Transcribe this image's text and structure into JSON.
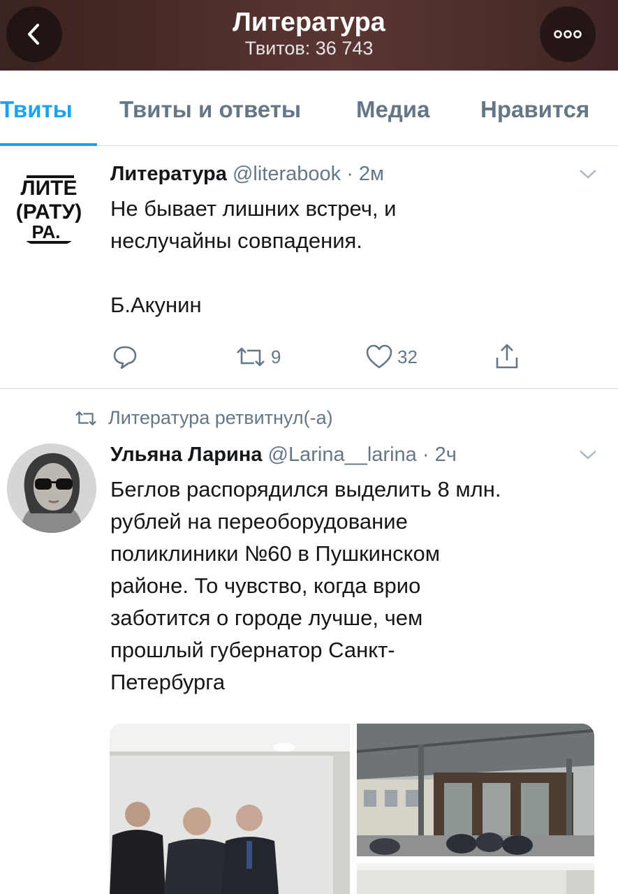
{
  "header": {
    "title": "Литература",
    "subtitle": "Твитов: 36 743",
    "back_icon": "chevron-left-icon",
    "more_icon": "more-dots-icon"
  },
  "tabs": [
    {
      "label": "Твиты",
      "active": true
    },
    {
      "label": "Твиты и ответы",
      "active": false
    },
    {
      "label": "Медиа",
      "active": false
    },
    {
      "label": "Нравится",
      "active": false
    }
  ],
  "tweet1": {
    "name": "Литература",
    "handle": "@literabook",
    "time": "· 2м",
    "text": "Не бывает лишних встреч, и\nнеслучайны совпадения.\n\nБ.Акунин",
    "replies": "",
    "retweets": "9",
    "likes": "32",
    "avatar_lines": [
      "ЛИТЕ",
      "РАТУ",
      "РА."
    ]
  },
  "retweet_banner": "Литература ретвитнул(-а)",
  "tweet2": {
    "name": "Ульяна Ларина",
    "handle": "@Larina__larina",
    "time": "· 2ч",
    "text": "Беглов распорядился выделить 8 млн.\nрублей на переоборудование\nполиклиники №60 в Пушкинском\nрайоне. То чувство, когда врио\nзаботится о городе лучше, чем\nпрошлый губернатор Санкт-\nПетербурга"
  },
  "colors": {
    "accent": "#1da1f2",
    "secondary_text": "#657786",
    "divider": "#d8dde1"
  }
}
